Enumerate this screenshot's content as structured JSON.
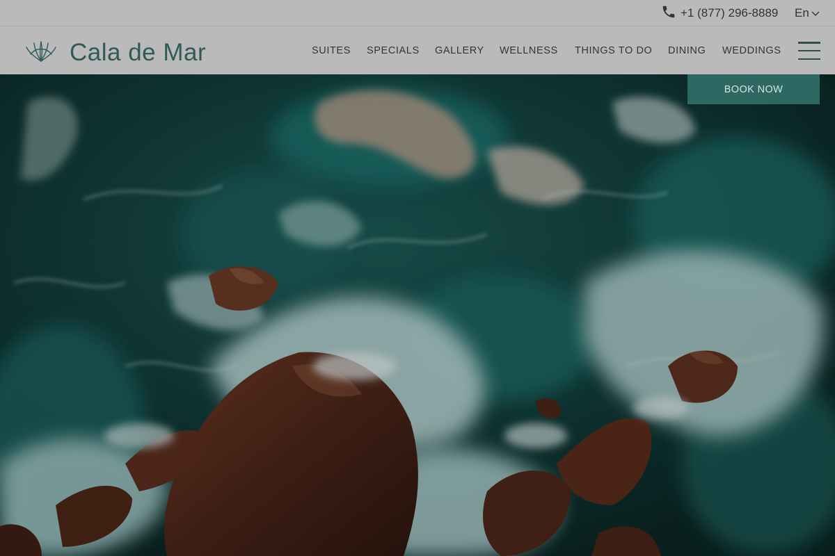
{
  "topbar": {
    "phone_icon": "phone-icon",
    "phone_number": "+1 (877) 296-8889",
    "language": "En",
    "language_icon": "chevron-down-icon"
  },
  "header": {
    "logo_icon": "lotus-logo-icon",
    "logo_text": "Cala de Mar",
    "nav": [
      {
        "label": "SUITES"
      },
      {
        "label": "SPECIALS"
      },
      {
        "label": "GALLERY"
      },
      {
        "label": "WELLNESS"
      },
      {
        "label": "THINGS TO DO"
      },
      {
        "label": "DINING"
      },
      {
        "label": "WEDDINGS"
      }
    ],
    "menu_icon": "hamburger-menu-icon"
  },
  "book_now": {
    "label": "BOOK NOW"
  },
  "colors": {
    "header_bg": "#bababa",
    "brand_teal": "#2e5b57",
    "book_button": "#2d6863",
    "nav_text": "#2f3438"
  }
}
